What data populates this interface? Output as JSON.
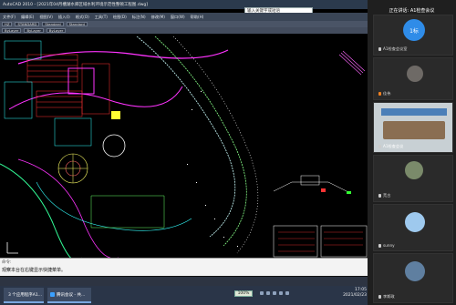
{
  "cad": {
    "title": "AutoCAD 2010 - [2021年04月槽湖水库区域水利环境示范性整顿工程图.dwg]",
    "search_placeholder": "输入关键字或短语",
    "menu": [
      "文件(F)",
      "编辑(E)",
      "视图(V)",
      "插入(I)",
      "格式(O)",
      "工具(T)",
      "绘图(D)",
      "标注(N)",
      "修改(M)",
      "窗口(W)",
      "帮助(H)"
    ],
    "toolbar_row1": [
      "HZ",
      "STANDARD",
      "Standard",
      "Standard"
    ],
    "toolbar_row2": [
      "ByLayer",
      "ByLayer",
      "ByLayer"
    ],
    "command_prompt": "命令:",
    "command_text": "观察本台在右键显示快捷菜单。"
  },
  "taskbar": {
    "items": [
      {
        "label": "3 个应用程序A1..."
      },
      {
        "label": "腾讯会议 - 共..."
      }
    ],
    "zoom": "100%",
    "time": "17:05",
    "date": "2021/02/23"
  },
  "meeting": {
    "header": "正在讲话: A1检查会议",
    "participants": [
      {
        "name": "A1检查会议室",
        "initials": "1标"
      },
      {
        "name": "佳伟"
      },
      {
        "name": "A1检查会议"
      },
      {
        "name": "荒古"
      },
      {
        "name": "sunny"
      },
      {
        "name": "李斯政"
      }
    ]
  },
  "colors": {
    "accent": "#2f8ce8",
    "cad_bg": "#000000",
    "panel_bg": "#1f1f1f"
  }
}
